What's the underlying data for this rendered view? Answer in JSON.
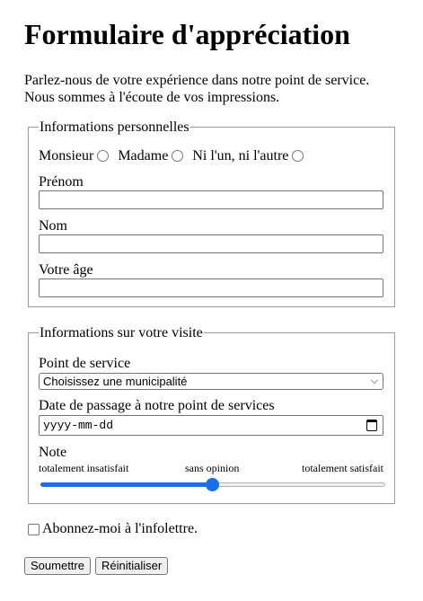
{
  "title": "Formulaire d'appréciation",
  "intro": {
    "line1": "Parlez-nous de votre expérience dans notre point de service.",
    "line2": "Nous sommes à l'écoute de vos impressions."
  },
  "personal": {
    "legend": "Informations personnelles",
    "radios": [
      "Monsieur",
      "Madame",
      "Ni l'un, ni l'autre"
    ],
    "firstname_label": "Prénom",
    "lastname_label": "Nom",
    "age_label": "Votre âge"
  },
  "visit": {
    "legend": "Informations sur votre visite",
    "service_label": "Point de service",
    "service_selected": "Choisissez une municipalité",
    "date_label": "Date de passage à notre point de services",
    "date_placeholder": "yyyy-mm-dd",
    "rating_label": "Note",
    "rating_low": "totalement insatisfait",
    "rating_mid": "sans opinion",
    "rating_high": "totalement satisfait",
    "rating_value_fraction": 0.5
  },
  "newsletter_label": "Abonnez-moi à l'infolettre.",
  "buttons": {
    "submit": "Soumettre",
    "reset": "Réinitialiser"
  },
  "colors": {
    "accent": "#1a6fe6",
    "border": "#767676"
  },
  "icons": {
    "select": "chevron-down-icon",
    "date": "calendar-icon"
  }
}
